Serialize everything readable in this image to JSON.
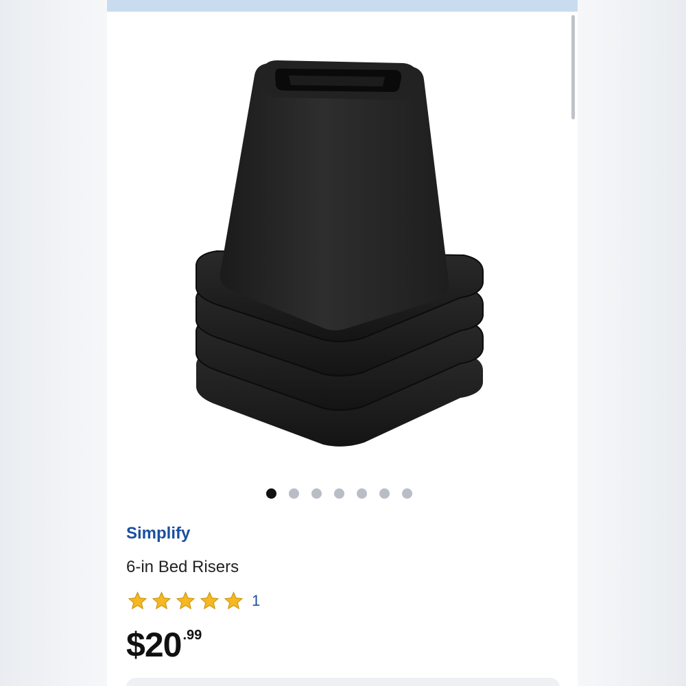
{
  "product": {
    "brand": "Simplify",
    "title": "6-in Bed Risers",
    "rating_value": 5,
    "rating_max": 5,
    "rating_count": "1",
    "price_currency": "$",
    "price_whole": "20",
    "price_cents": ".99",
    "image_icon": "bed-riser-product-image"
  },
  "carousel": {
    "total": 7,
    "active_index": 0
  },
  "colors": {
    "brand_blue": "#1a4fa0",
    "star_gold": "#f5b820",
    "top_strip": "#c9dcef"
  }
}
